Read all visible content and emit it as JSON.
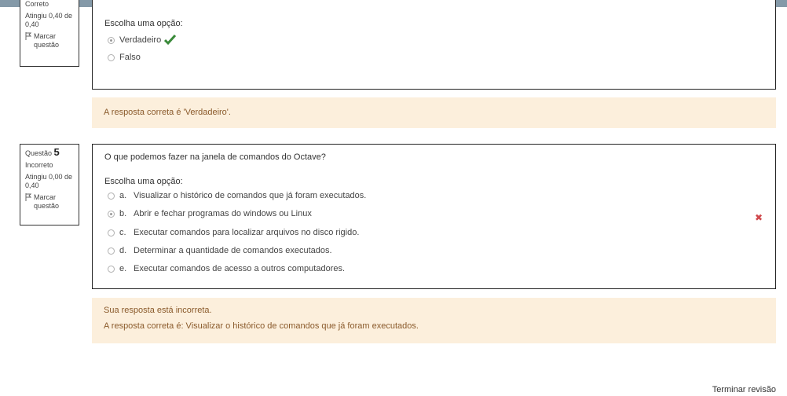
{
  "q4": {
    "state": "Correto",
    "grade": "Atingiu 0,40 de 0,40",
    "flag_label": "Marcar questão",
    "prompt": "Escolha uma opção:",
    "options": [
      {
        "label": "Verdadeiro",
        "checked": true,
        "mark": "check-icon"
      },
      {
        "label": "Falso",
        "checked": false
      }
    ],
    "feedback": "A resposta correta é 'Verdadeiro'."
  },
  "q5": {
    "number_label": "Questão",
    "number": "5",
    "state": "Incorreto",
    "grade": "Atingiu 0,00 de 0,40",
    "flag_label": "Marcar questão",
    "question": "O que podemos fazer na janela de comandos do Octave?",
    "prompt": "Escolha uma opção:",
    "options": [
      {
        "letter": "a.",
        "label": "Visualizar o histórico de comandos que já foram executados.",
        "checked": false
      },
      {
        "letter": "b.",
        "label": "Abrir e fechar programas do windows ou Linux",
        "checked": true
      },
      {
        "letter": "c.",
        "label": "Executar comandos para localizar arquivos no disco rigido.",
        "checked": false
      },
      {
        "letter": "d.",
        "label": "Determinar a quantidade de comandos executados.",
        "checked": false
      },
      {
        "letter": "e.",
        "label": "Executar comandos de acesso a outros computadores.",
        "checked": false
      }
    ],
    "incorrect_mark": "✖",
    "feedback_status": "Sua resposta está incorreta.",
    "feedback_answer": "A resposta correta é: Visualizar o histórico de comandos que já foram executados."
  },
  "footer": {
    "finish_review": "Terminar revisão"
  },
  "colors": {
    "topbar": "#8499a8",
    "feedback_bg": "#fcefdc",
    "feedback_text": "#8a5a2b",
    "check": "#3a8a3a",
    "cross": "#d0494d"
  }
}
